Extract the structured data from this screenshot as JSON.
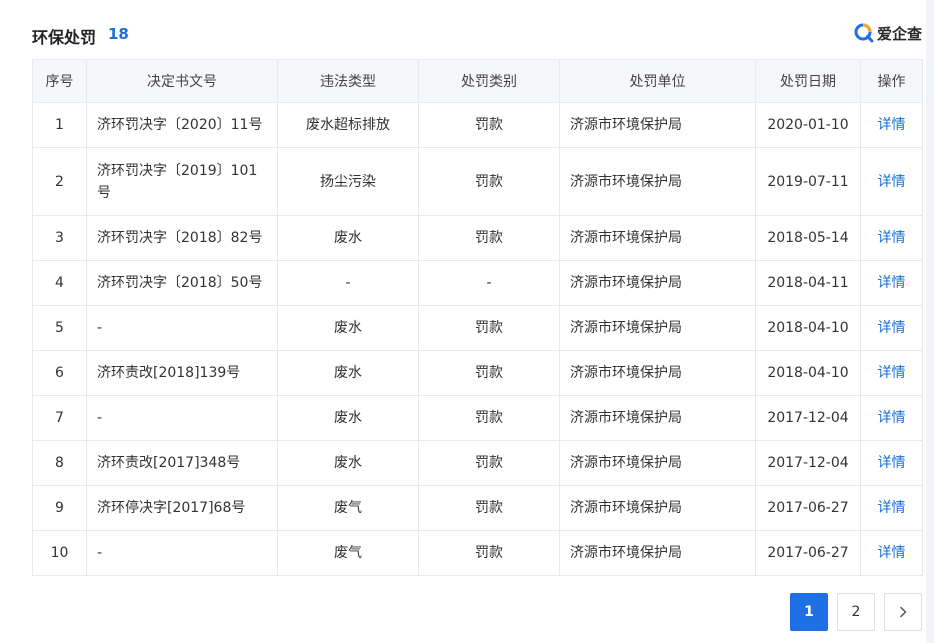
{
  "header": {
    "title": "环保处罚",
    "count": "18",
    "brand_name": "爱企查"
  },
  "colors": {
    "accent": "#1f6fe5",
    "link": "#1a6fd4",
    "header_bg": "#f5f7fa",
    "border": "#e6e9ee"
  },
  "table": {
    "columns": [
      "序号",
      "决定书文号",
      "违法类型",
      "处罚类别",
      "处罚单位",
      "处罚日期",
      "操作"
    ],
    "rows": [
      {
        "no": "1",
        "doc": "济环罚决字〔2020〕11号",
        "type": "废水超标排放",
        "category": "罚款",
        "unit": "济源市环境保护局",
        "date": "2020-01-10",
        "action": "详情"
      },
      {
        "no": "2",
        "doc": "济环罚决字〔2019〕101号",
        "type": "扬尘污染",
        "category": "罚款",
        "unit": "济源市环境保护局",
        "date": "2019-07-11",
        "action": "详情"
      },
      {
        "no": "3",
        "doc": "济环罚决字〔2018〕82号",
        "type": "废水",
        "category": "罚款",
        "unit": "济源市环境保护局",
        "date": "2018-05-14",
        "action": "详情"
      },
      {
        "no": "4",
        "doc": "济环罚决字〔2018〕50号",
        "type": "-",
        "category": "-",
        "unit": "济源市环境保护局",
        "date": "2018-04-11",
        "action": "详情"
      },
      {
        "no": "5",
        "doc": "-",
        "type": "废水",
        "category": "罚款",
        "unit": "济源市环境保护局",
        "date": "2018-04-10",
        "action": "详情"
      },
      {
        "no": "6",
        "doc": "济环责改[2018]139号",
        "type": "废水",
        "category": "罚款",
        "unit": "济源市环境保护局",
        "date": "2018-04-10",
        "action": "详情"
      },
      {
        "no": "7",
        "doc": "-",
        "type": "废水",
        "category": "罚款",
        "unit": "济源市环境保护局",
        "date": "2017-12-04",
        "action": "详情"
      },
      {
        "no": "8",
        "doc": "济环责改[2017]348号",
        "type": "废水",
        "category": "罚款",
        "unit": "济源市环境保护局",
        "date": "2017-12-04",
        "action": "详情"
      },
      {
        "no": "9",
        "doc": "济环停决字[2017]68号",
        "type": "废气",
        "category": "罚款",
        "unit": "济源市环境保护局",
        "date": "2017-06-27",
        "action": "详情"
      },
      {
        "no": "10",
        "doc": "-",
        "type": "废气",
        "category": "罚款",
        "unit": "济源市环境保护局",
        "date": "2017-06-27",
        "action": "详情"
      }
    ]
  },
  "pagination": {
    "pages": [
      "1",
      "2"
    ],
    "current": "1",
    "next_icon": "chevron-right-icon"
  }
}
